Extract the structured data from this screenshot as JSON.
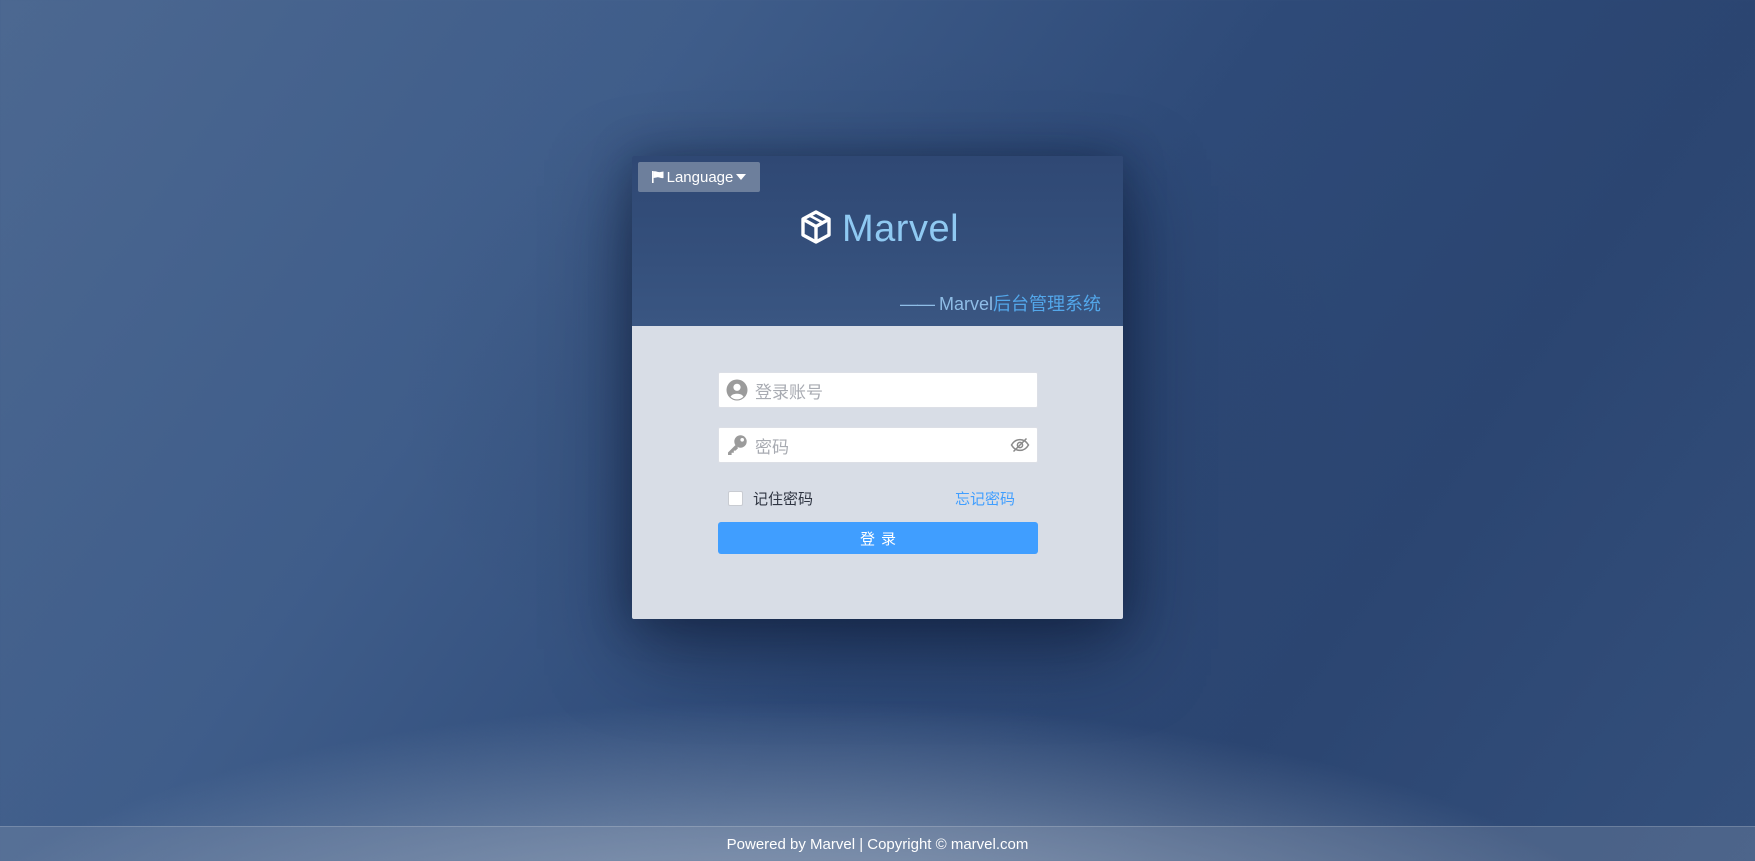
{
  "header": {
    "language_label": "Language",
    "language_icon": "flag-icon",
    "dropdown_icon": "caret-down-icon",
    "brand_icon": "cube-icon",
    "brand_name": "Marvel",
    "subtitle_dash": "——",
    "subtitle_brand": " Marvel",
    "subtitle_cn": "后台管理系统"
  },
  "form": {
    "username_placeholder": "登录账号",
    "username_icon": "user-circle-icon",
    "password_placeholder": "密码",
    "password_icon": "key-icon",
    "visibility_icon": "eye-slash-icon",
    "remember_label": "记住密码",
    "remember_checked": false,
    "forgot_label": "忘记密码",
    "login_label": "登录"
  },
  "footer": {
    "text": "Powered by Marvel | Copyright © marvel.com"
  },
  "colors": {
    "accent": "#409eff",
    "brand_text": "#8fc9f2",
    "header_bg": "#344f7b",
    "body_bg": "#d8dde6"
  }
}
